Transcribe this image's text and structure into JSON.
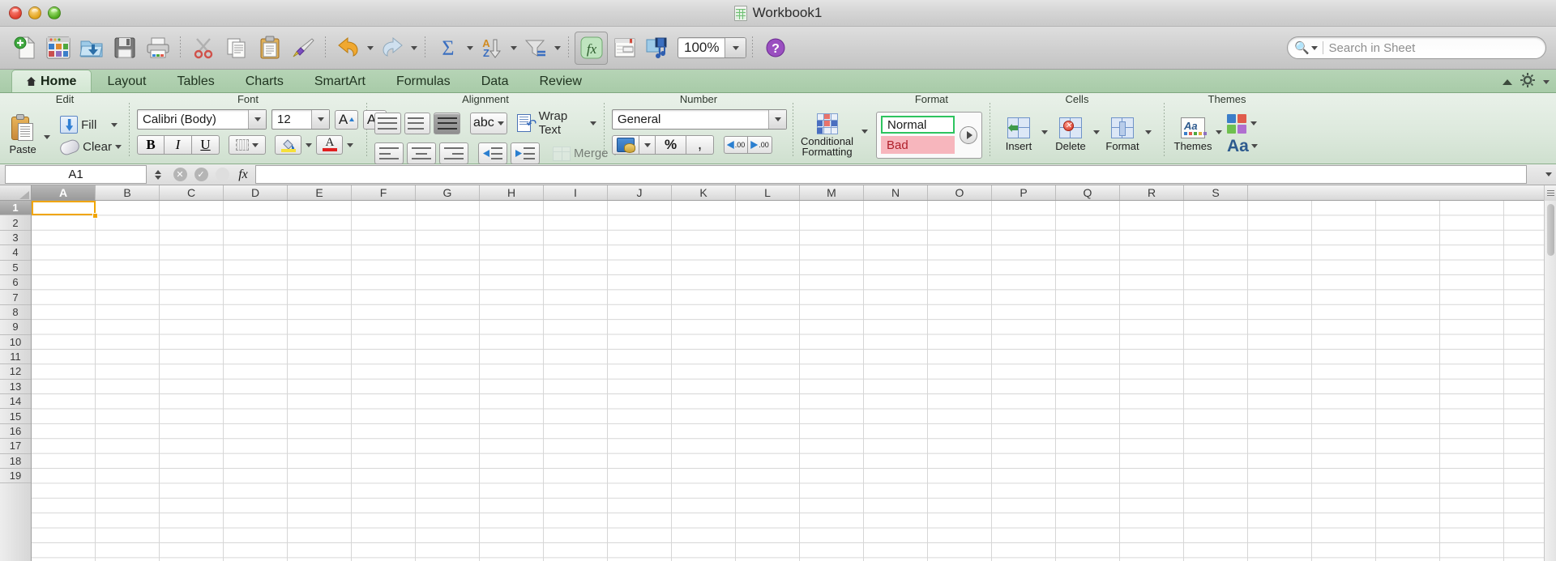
{
  "window": {
    "title": "Workbook1",
    "doc_icon": "excel-document-icon",
    "controls": [
      "close",
      "minimize",
      "maximize"
    ]
  },
  "toolbar": {
    "buttons": [
      {
        "name": "new-workbook",
        "icon": "new-document-icon"
      },
      {
        "name": "open-template-gallery",
        "icon": "template-gallery-icon"
      },
      {
        "name": "open",
        "icon": "open-folder-icon"
      },
      {
        "name": "save",
        "icon": "floppy-save-icon"
      },
      {
        "name": "print",
        "icon": "printer-icon"
      },
      {
        "name": "cut",
        "icon": "scissors-icon"
      },
      {
        "name": "copy",
        "icon": "copy-icon"
      },
      {
        "name": "paste",
        "icon": "clipboard-paste-icon"
      },
      {
        "name": "format-painter",
        "icon": "paintbrush-icon"
      },
      {
        "name": "undo",
        "icon": "undo-arrow-icon"
      },
      {
        "name": "redo",
        "icon": "redo-arrow-icon"
      },
      {
        "name": "autosum",
        "icon": "sigma-icon"
      },
      {
        "name": "sort",
        "icon": "sort-az-icon"
      },
      {
        "name": "filter",
        "icon": "funnel-icon"
      },
      {
        "name": "formula-builder",
        "icon": "fx-icon"
      },
      {
        "name": "toolbox",
        "icon": "toolbox-icon"
      },
      {
        "name": "media-browser",
        "icon": "media-browser-icon"
      },
      {
        "name": "help",
        "icon": "help-question-icon"
      }
    ],
    "zoom": "100%",
    "search_placeholder": "Search in Sheet",
    "search_value": ""
  },
  "tabs": [
    {
      "label": "Home",
      "active": true,
      "icon": "home-icon"
    },
    {
      "label": "Layout",
      "active": false
    },
    {
      "label": "Tables",
      "active": false
    },
    {
      "label": "Charts",
      "active": false
    },
    {
      "label": "SmartArt",
      "active": false
    },
    {
      "label": "Formulas",
      "active": false
    },
    {
      "label": "Data",
      "active": false
    },
    {
      "label": "Review",
      "active": false
    }
  ],
  "ribbon": {
    "groups": {
      "edit": {
        "title": "Edit",
        "paste": "Paste",
        "fill": "Fill",
        "clear": "Clear"
      },
      "font": {
        "title": "Font",
        "font_name": "Calibri (Body)",
        "font_size": "12",
        "grow_label": "A",
        "shrink_label": "A",
        "bold": "B",
        "italic": "I",
        "underline": "U"
      },
      "alignment": {
        "title": "Alignment",
        "orientation_label": "abc",
        "wrap_text": "Wrap Text",
        "merge": "Merge"
      },
      "number": {
        "title": "Number",
        "format": "General",
        "percent": "%",
        "comma": ",",
        "decrease_decimal": ".00",
        "increase_decimal": ".00"
      },
      "format": {
        "title": "Format",
        "conditional_formatting": "Conditional\nFormatting",
        "conditional_line1": "Conditional",
        "conditional_line2": "Formatting",
        "styles": [
          "Normal",
          "Bad"
        ]
      },
      "cells": {
        "title": "Cells",
        "insert": "Insert",
        "delete": "Delete",
        "format": "Format"
      },
      "themes": {
        "title": "Themes",
        "themes": "Themes",
        "colors_label": "Aa"
      }
    }
  },
  "formula_bar": {
    "name_box": "A1",
    "formula_value": "",
    "cancel_icon": "cancel-x-icon",
    "accept_icon": "accept-check-icon",
    "fx_label": "fx"
  },
  "grid": {
    "columns": [
      "A",
      "B",
      "C",
      "D",
      "E",
      "F",
      "G",
      "H",
      "I",
      "J",
      "K",
      "L",
      "M",
      "N",
      "O",
      "P",
      "Q",
      "R",
      "S"
    ],
    "rows": [
      "1",
      "2",
      "3",
      "4",
      "5",
      "6",
      "7",
      "8",
      "9",
      "10",
      "11",
      "12",
      "13",
      "14",
      "15",
      "16",
      "17",
      "18",
      "19"
    ],
    "selected_cell": "A1",
    "selected_column": "A",
    "selected_row": "1"
  },
  "colors": {
    "ribbon_green": "#cfe0cf",
    "tab_green": "#a8cba8",
    "selection_orange": "#f0a500",
    "style_good_border": "#2ec45f",
    "style_bad_bg": "#f7b6bd",
    "style_bad_text": "#b0202b"
  }
}
